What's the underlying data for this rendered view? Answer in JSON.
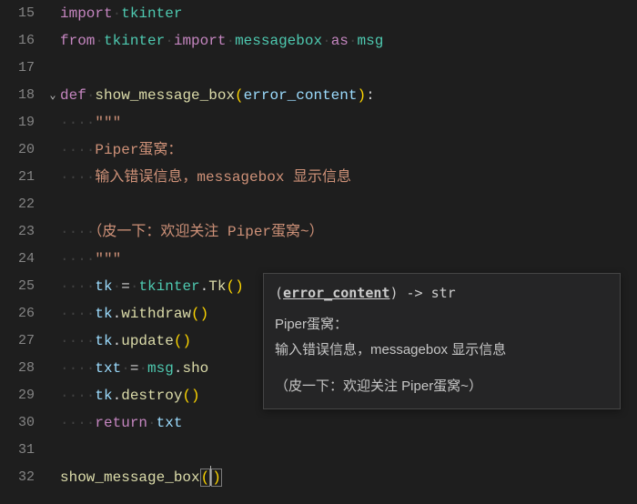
{
  "lineNumbers": [
    "15",
    "16",
    "17",
    "18",
    "19",
    "20",
    "21",
    "22",
    "23",
    "24",
    "25",
    "26",
    "27",
    "28",
    "29",
    "30",
    "31",
    "32"
  ],
  "fold": {
    "18": "⌄"
  },
  "code": {
    "15": {
      "kw1": "import",
      "sp": " ",
      "mod": "tkinter"
    },
    "16": {
      "kw1": "from",
      "mod1": "tkinter",
      "kw2": "import",
      "mod2": "messagebox",
      "kw3": "as",
      "mod3": "msg"
    },
    "18": {
      "kw": "def",
      "fn": "show_message_box",
      "lp": "(",
      "parm": "error_content",
      "rp": ")",
      "colon": ":"
    },
    "19": {
      "q": "\"\"\""
    },
    "20": {
      "t": "Piper蛋窝："
    },
    "21": {
      "t": "输入错误信息，messagebox 显示信息"
    },
    "23": {
      "t": "（皮一下：欢迎关注 Piper蛋窝~）"
    },
    "24": {
      "q": "\"\"\""
    },
    "25": {
      "v": "tk",
      "eq": "=",
      "m": "tkinter",
      "dot": ".",
      "fn": "Tk",
      "lp": "(",
      "rp": ")"
    },
    "26": {
      "v": "tk",
      "dot": ".",
      "fn": "withdraw",
      "lp": "(",
      "rp": ")"
    },
    "27": {
      "v": "tk",
      "dot": ".",
      "fn": "update",
      "lp": "(",
      "rp": ")"
    },
    "28": {
      "v": "txt",
      "eq": "=",
      "m": "msg",
      "dot": ".",
      "fn": "sho"
    },
    "29": {
      "v": "tk",
      "dot": ".",
      "fn": "destroy",
      "lp": "(",
      "rp": ")"
    },
    "30": {
      "kw": "return",
      "v": "txt"
    },
    "32": {
      "fn": "show_message_box",
      "lp": "(",
      "rp": ")"
    }
  },
  "tooltip": {
    "sig_pre": "(",
    "sig_param": "error_content",
    "sig_post": ") -> str",
    "doc1": "Piper蛋窝：",
    "doc2": "输入错误信息，messagebox 显示信息",
    "doc3": "（皮一下：欢迎关注 Piper蛋窝~）"
  },
  "ws": {
    "ind1": "····",
    "ind2": "········",
    "ind1x": "····",
    "dot": "·"
  }
}
